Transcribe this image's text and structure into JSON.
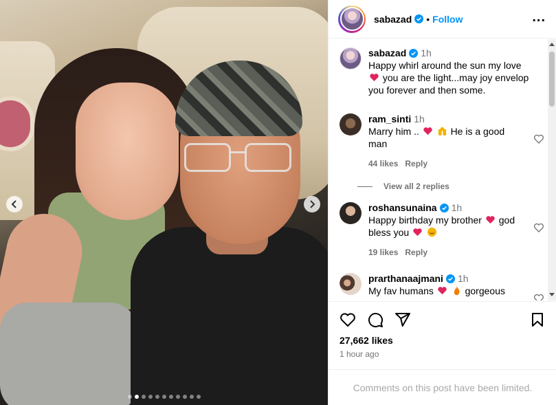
{
  "header": {
    "username": "sabazad",
    "separator": "•",
    "follow_label": "Follow",
    "more_label": "..."
  },
  "caption": {
    "username": "sabazad",
    "time": "1h",
    "text_part1": "Happy whirl around the sun my love",
    "text_part2": "you are the light...may joy envelop you forever and then some."
  },
  "comments": [
    {
      "username": "ram_sinti",
      "time": "1h",
      "text_part1": "Marry him ..",
      "text_part2": "He is a good man",
      "likes": "44 likes",
      "reply": "Reply",
      "view_replies": "View all 2 replies"
    },
    {
      "username": "roshansunaina",
      "time": "1h",
      "text_part1": "Happy birthday my brother",
      "text_part2": "god bless you",
      "likes": "19 likes",
      "reply": "Reply"
    },
    {
      "username": "prarthanaajmani",
      "time": "1h",
      "text_part1": "My fav humans",
      "text_part2": "gorgeous"
    }
  ],
  "post": {
    "likes": "27,662 likes",
    "posted": "1 hour ago",
    "comments_limited": "Comments on this post have been limited.",
    "carousel_count": 11,
    "carousel_index": 1
  },
  "colors": {
    "accent": "#0095f6",
    "heart": "#e0245e",
    "muted": "#737373"
  },
  "icons": [
    "verified-icon",
    "more-icon",
    "heart-icon",
    "comment-icon",
    "share-icon",
    "bookmark-icon",
    "chevron-left-icon",
    "chevron-right-icon",
    "red-heart-emoji",
    "hands-emoji",
    "fire-emoji",
    "smile-emoji"
  ]
}
